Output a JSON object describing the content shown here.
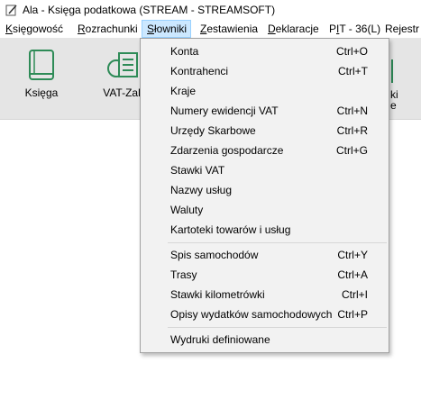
{
  "window": {
    "title": "Ala - Księga podatkowa (STREAM - STREAMSOFT)"
  },
  "menubar": {
    "items": [
      {
        "label": "Księgowość",
        "access_key": "K"
      },
      {
        "label": "Rozrachunki",
        "access_key": "R"
      },
      {
        "label": "Słowniki",
        "access_key": "S",
        "active": true
      },
      {
        "label": "Zestawienia",
        "access_key": "Z"
      },
      {
        "label": "Deklaracje",
        "access_key": "D"
      },
      {
        "label": "PIT - 36(L)",
        "access_key": "I"
      },
      {
        "label": "Rejestr",
        "access_key": ""
      }
    ]
  },
  "toolbar": {
    "items": [
      {
        "label": "Księga",
        "icon": "book-icon"
      },
      {
        "label": "VAT-Zaku",
        "icon": "vat-purchase-icon"
      },
      {
        "label": "ki",
        "label2": "e",
        "icon": "partial-icon"
      }
    ]
  },
  "dropdown": {
    "groups": [
      [
        {
          "label": "Konta",
          "shortcut": "Ctrl+O"
        },
        {
          "label": "Kontrahenci",
          "shortcut": "Ctrl+T"
        },
        {
          "label": "Kraje",
          "shortcut": ""
        },
        {
          "label": "Numery ewidencji VAT",
          "shortcut": "Ctrl+N"
        },
        {
          "label": "Urzędy Skarbowe",
          "shortcut": "Ctrl+R"
        },
        {
          "label": "Zdarzenia gospodarcze",
          "shortcut": "Ctrl+G"
        },
        {
          "label": "Stawki VAT",
          "shortcut": ""
        },
        {
          "label": "Nazwy usług",
          "shortcut": ""
        },
        {
          "label": "Waluty",
          "shortcut": ""
        },
        {
          "label": "Kartoteki towarów i usług",
          "shortcut": ""
        }
      ],
      [
        {
          "label": "Spis samochodów",
          "shortcut": "Ctrl+Y"
        },
        {
          "label": "Trasy",
          "shortcut": "Ctrl+A"
        },
        {
          "label": "Stawki kilometrówki",
          "shortcut": "Ctrl+I"
        },
        {
          "label": "Opisy wydatków samochodowych",
          "shortcut": "Ctrl+P"
        }
      ],
      [
        {
          "label": "Wydruki definiowane",
          "shortcut": ""
        }
      ]
    ]
  },
  "colors": {
    "accent": "#2e8b57",
    "menu_highlight": "#cce8ff",
    "ribbon_bg": "#e5e5e5"
  }
}
